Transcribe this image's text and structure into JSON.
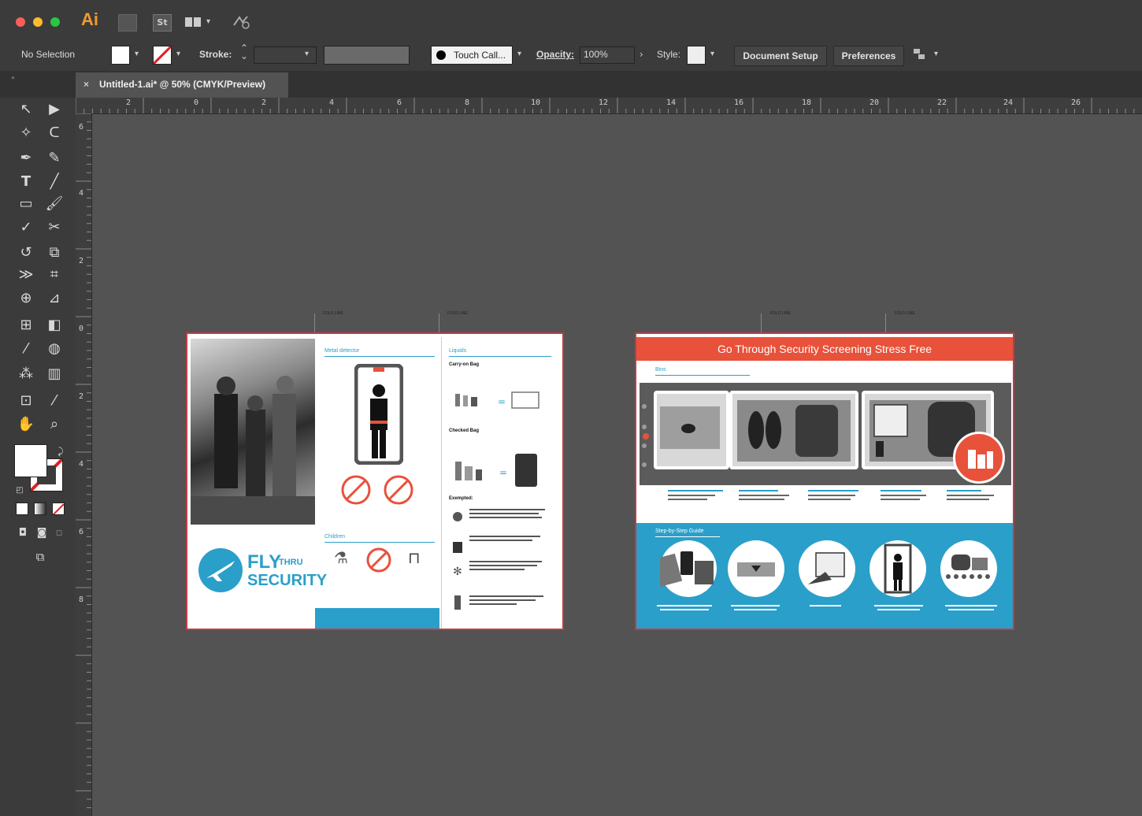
{
  "app": {
    "name": "Ai",
    "bridge_label": "St"
  },
  "control_bar": {
    "selection_status": "No Selection",
    "stroke_label": "Stroke:",
    "brush_label": "Touch Call...",
    "opacity_label": "Opacity:",
    "opacity_value": "100%",
    "style_label": "Style:",
    "document_setup_label": "Document Setup",
    "preferences_label": "Preferences"
  },
  "document_tab": {
    "close_glyph": "×",
    "title": "Untitled-1.ai* @ 50% (CMYK/Preview)"
  },
  "rulers": {
    "horizontal": [
      "2",
      "0",
      "2",
      "4",
      "6",
      "8",
      "10",
      "12",
      "14",
      "16",
      "18",
      "20",
      "22",
      "24",
      "26"
    ],
    "vertical": [
      "6",
      "4",
      "2",
      "0",
      "2",
      "4",
      "6",
      "8"
    ]
  },
  "artboard_left": {
    "fold_line_label": "FOLD LINE",
    "logo_line1": "FLY",
    "logo_line2": "THRU",
    "logo_line3": "SECURITY",
    "panel2_heading": "Metal detector",
    "panel2_children_heading": "Children",
    "panel3_heading": "Liquids",
    "carry_on_heading": "Carry-on Bag",
    "checked_heading": "Checked Bag",
    "exempted_heading": "Exempted:"
  },
  "artboard_right": {
    "fold_line_label": "FOLD LINE",
    "banner_title": "Go Through Security Screening Stress Free",
    "bins_heading": "Bins",
    "step_guide_heading": "Step-by-Step Guide"
  },
  "colors": {
    "accent_red": "#e8513a",
    "accent_blue": "#2a9fc9",
    "artboard_border": "#c33a47",
    "canvas": "#535353"
  }
}
